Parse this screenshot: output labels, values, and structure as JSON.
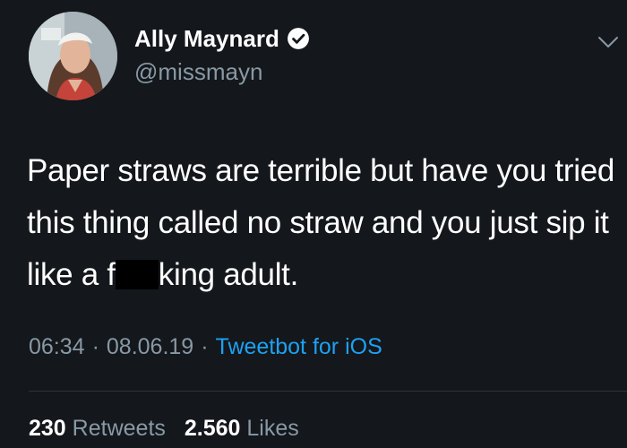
{
  "user": {
    "display_name": "Ally Maynard",
    "handle": "@missmayn",
    "avatar_icon": "profile-photo",
    "verified_icon": "verified-badge-icon"
  },
  "tweet": {
    "text_before_censor": "Paper straws are terrible but have you tried this thing called no straw and you just sip it like a f",
    "text_after_censor": "king adult."
  },
  "meta": {
    "time": "06:34",
    "separator": "·",
    "date": "08.06.19",
    "source": "Tweetbot for iOS"
  },
  "stats": {
    "retweets_count": "230",
    "retweets_label": "Retweets",
    "likes_count": "2.560",
    "likes_label": "Likes"
  },
  "colors": {
    "background": "#14171b",
    "accent": "#1da1f2",
    "muted": "#8899a6"
  }
}
